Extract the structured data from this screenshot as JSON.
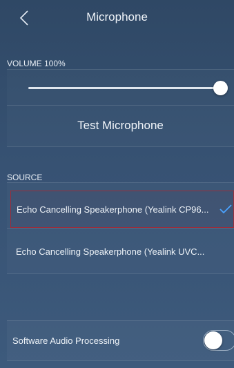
{
  "header": {
    "back_icon": "chevron-left-icon",
    "title": "Microphone"
  },
  "volume": {
    "label": "VOLUME 100%",
    "level_fraction": 1.0
  },
  "test_button": {
    "label": "Test Microphone"
  },
  "source": {
    "label": "SOURCE",
    "items": [
      {
        "label": "Echo Cancelling Speakerphone (Yealink CP96...",
        "selected": true
      },
      {
        "label": "Echo Cancelling Speakerphone (Yealink UVC...",
        "selected": false
      }
    ],
    "selected_icon": "checkmark-icon"
  },
  "software_audio": {
    "label": "Software Audio Processing",
    "enabled": false
  },
  "colors": {
    "background": "#375273",
    "selected_border": "#9b2d3b",
    "check": "#4aa3ff"
  }
}
